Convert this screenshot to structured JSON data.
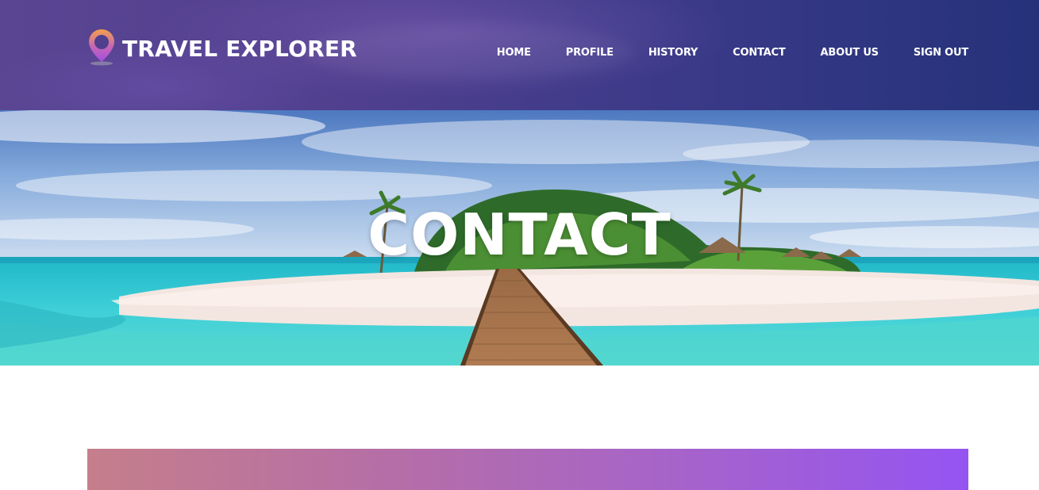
{
  "brand": {
    "title": "TRAVEL EXPLORER",
    "icon": "map-pin-icon",
    "icon_colors": [
      "#f5a04a",
      "#a44fe0"
    ]
  },
  "nav": {
    "items": [
      {
        "label": "HOME"
      },
      {
        "label": "PROFILE"
      },
      {
        "label": "HISTORY"
      },
      {
        "label": "CONTACT"
      },
      {
        "label": "ABOUT US"
      },
      {
        "label": "SIGN OUT"
      }
    ]
  },
  "hero": {
    "title": "CONTACT",
    "image": "tropical-island-pier-image"
  },
  "colors": {
    "header_start": "#5a4592",
    "header_end": "#25327a",
    "bar_start": "#c57e8b",
    "bar_end": "#9554f2"
  }
}
